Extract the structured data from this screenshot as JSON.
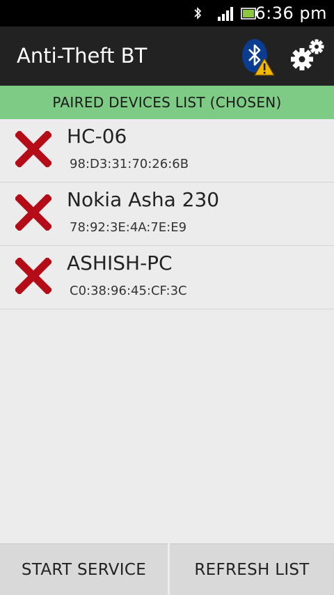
{
  "status_bar": {
    "time": "6:36 pm",
    "icons": [
      "bluetooth-icon",
      "signal-icon",
      "battery-icon"
    ]
  },
  "action_bar": {
    "title": "Anti-Theft BT",
    "icons": [
      "bluetooth-warning-icon",
      "settings-gears-icon"
    ]
  },
  "list_header": "PAIRED DEVICES LIST (CHOSEN)",
  "devices": [
    {
      "name": "HC-06",
      "mac": "98:D3:31:70:26:6B",
      "icon": "remove-x-icon"
    },
    {
      "name": "Nokia Asha 230",
      "mac": "78:92:3E:4A:7E:E9",
      "icon": "remove-x-icon"
    },
    {
      "name": "ASHISH-PC",
      "mac": "C0:38:96:45:CF:3C",
      "icon": "remove-x-icon"
    }
  ],
  "buttons": {
    "start_service": "START SERVICE",
    "refresh_list": "REFRESH LIST"
  },
  "colors": {
    "header_green": "#7dcb85",
    "x_red": "#b50d18",
    "bluetooth_blue": "#0a3d91",
    "warning_yellow": "#f5b800",
    "action_bar": "#222222"
  }
}
